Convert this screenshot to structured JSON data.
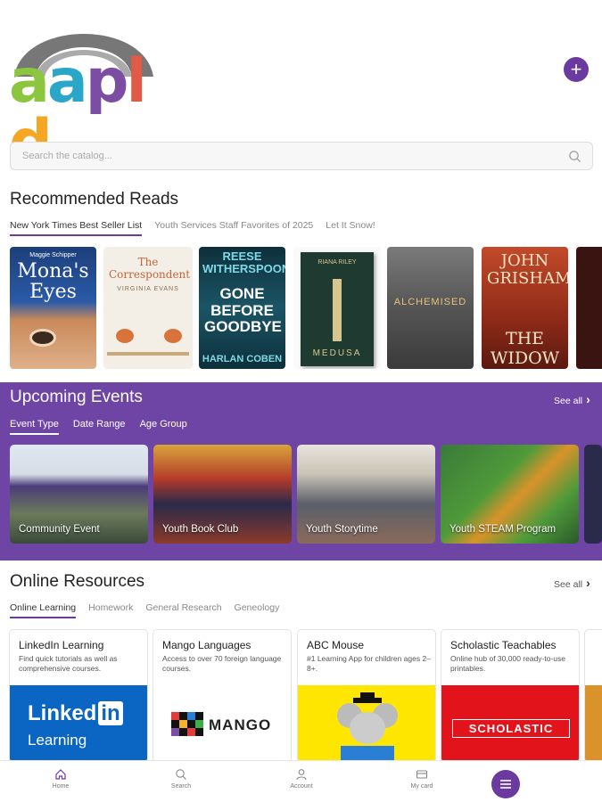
{
  "header": {
    "logo_text": "aapld",
    "add_button_symbol": "+"
  },
  "search": {
    "placeholder": "Search the catalog..."
  },
  "recommended": {
    "title": "Recommended Reads",
    "tabs": [
      "New York Times Best Seller List",
      "Youth Services Staff Favorites of 2025",
      "Let It Snow!"
    ],
    "books": [
      {
        "cover_top": "Maggie Schipper",
        "cover_title": "Mona's Eyes",
        "cover_author": ""
      },
      {
        "cover_top": "",
        "cover_title": "The Correspondent",
        "cover_author": "VIRGINIA EVANS"
      },
      {
        "cover_top": "REESE WITHERSPOON",
        "cover_title": "GONE BEFORE GOODBYE",
        "cover_author": "HARLAN COBEN"
      },
      {
        "cover_top": "RIANA RILEY",
        "cover_title": "MEDUSA",
        "cover_author": ""
      },
      {
        "cover_top": "",
        "cover_title": "ALCHEMISED",
        "cover_author": ""
      },
      {
        "cover_top": "JOHN GRISHAM",
        "cover_title": "THE WIDOW",
        "cover_author": ""
      }
    ]
  },
  "events": {
    "title": "Upcoming Events",
    "see_all": "See all",
    "tabs": [
      "Event Type",
      "Date Range",
      "Age Group"
    ],
    "cards": [
      "Community Event",
      "Youth Book Club",
      "Youth Storytime",
      "Youth STEAM Program"
    ]
  },
  "resources": {
    "title": "Online Resources",
    "see_all": "See all",
    "tabs": [
      "Online Learning",
      "Homework",
      "General Research",
      "Geneology"
    ],
    "cards": [
      {
        "title": "LinkedIn Learning",
        "desc": "Find quick tutorials as well as comprehensive courses.",
        "logo_a": "Linked",
        "logo_b": "in",
        "logo_c": "Learning"
      },
      {
        "title": "Mango Languages",
        "desc": "Access to over 70 foreign language courses.",
        "logo_a": "MANGO"
      },
      {
        "title": "ABC Mouse",
        "desc": "#1 Learning App for children ages 2–8+.",
        "logo_a": ""
      },
      {
        "title": "Scholastic Teachables",
        "desc": "Online hub of 30,000 ready-to-use printables.",
        "logo_a": "SCHOLASTIC"
      }
    ]
  },
  "bottom_nav": {
    "items": [
      "Home",
      "Search",
      "Account",
      "My card"
    ]
  },
  "colors": {
    "brand_purple": "#6b3aa0",
    "events_bg": "#6e44a4"
  }
}
